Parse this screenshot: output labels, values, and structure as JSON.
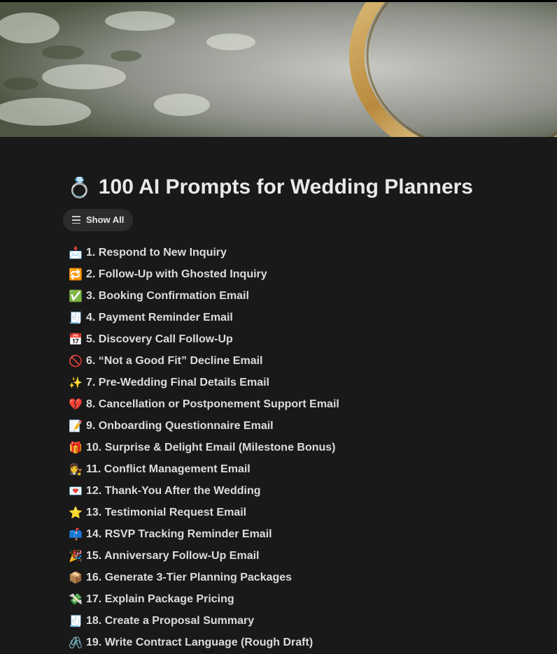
{
  "cover": {
    "description_alt": "wedding ring on lace"
  },
  "page": {
    "icon": "💍",
    "title": "100 AI Prompts for Wedding Planners"
  },
  "view_button": {
    "label": "Show All",
    "icon": "list-icon"
  },
  "items": [
    {
      "emoji": "📩",
      "label": "1. Respond to New Inquiry"
    },
    {
      "emoji": "🔁",
      "label": "2. Follow-Up with Ghosted Inquiry"
    },
    {
      "emoji": "✅",
      "label": "3. Booking Confirmation Email"
    },
    {
      "emoji": "🧾",
      "label": "4. Payment Reminder Email"
    },
    {
      "emoji": "📅",
      "label": "5. Discovery Call Follow-Up"
    },
    {
      "emoji": "🚫",
      "label": "6. “Not a Good Fit” Decline Email"
    },
    {
      "emoji": "✨",
      "label": "7. Pre-Wedding Final Details Email"
    },
    {
      "emoji": "💔",
      "label": "8. Cancellation or Postponement Support Email"
    },
    {
      "emoji": "📝",
      "label": "9. Onboarding Questionnaire Email"
    },
    {
      "emoji": "🎁",
      "label": "10. Surprise & Delight Email (Milestone Bonus)"
    },
    {
      "emoji": "👩‍⚖️",
      "label": "11. Conflict Management Email"
    },
    {
      "emoji": "💌",
      "label": "12. Thank-You After the Wedding"
    },
    {
      "emoji": "⭐",
      "label": "13. Testimonial Request Email"
    },
    {
      "emoji": "📫",
      "label": "14. RSVP Tracking Reminder Email"
    },
    {
      "emoji": "🎉",
      "label": "15. Anniversary Follow-Up Email"
    },
    {
      "emoji": "📦",
      "label": "16. Generate 3-Tier Planning Packages"
    },
    {
      "emoji": "💸",
      "label": "17. Explain Package Pricing"
    },
    {
      "emoji": "🧾",
      "label": "18. Create a Proposal Summary"
    },
    {
      "emoji": "🖇️",
      "label": "19. Write Contract Language (Rough Draft)"
    }
  ]
}
